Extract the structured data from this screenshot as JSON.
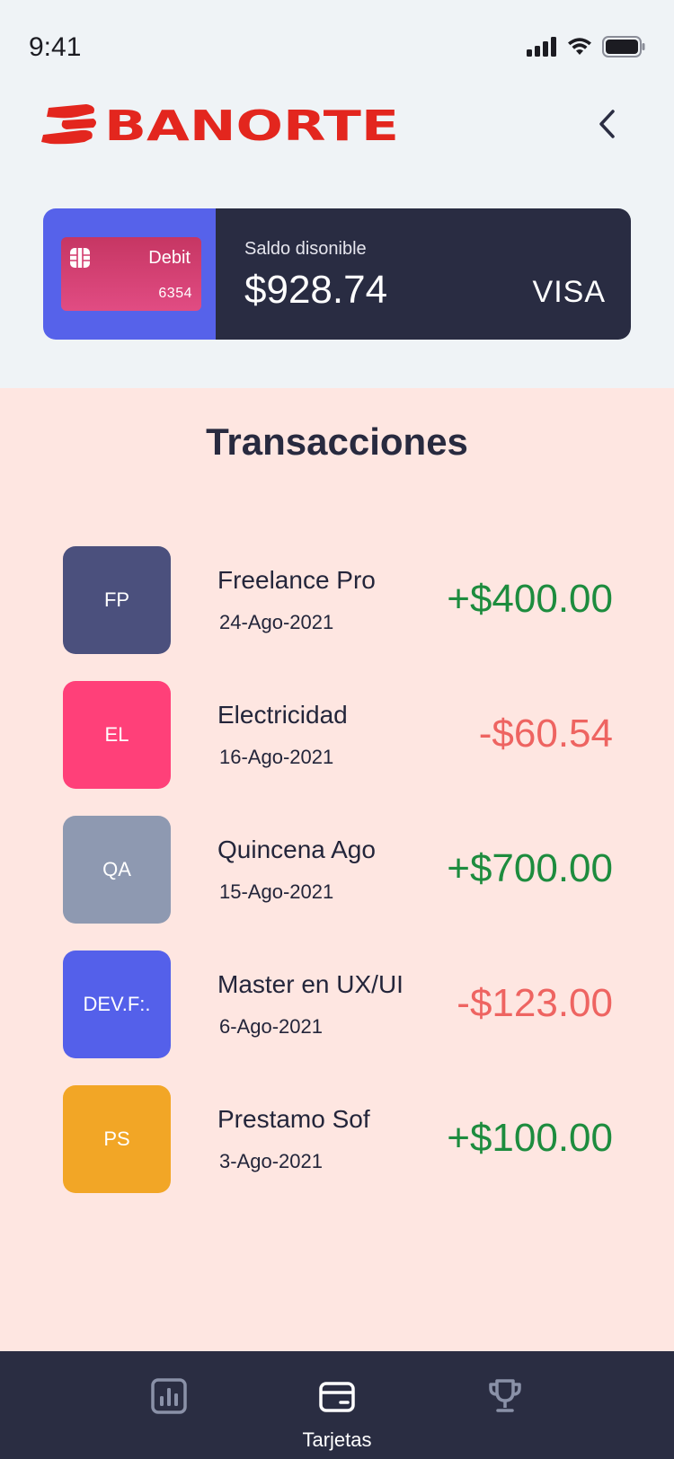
{
  "status": {
    "time": "9:41"
  },
  "header": {
    "brand": "BANORTE"
  },
  "account": {
    "card_type": "Debit",
    "card_last_digits": "6354",
    "balance_label": "Saldo disonible",
    "balance": "$928.74",
    "network": "VISA"
  },
  "transactions": {
    "title": "Transacciones",
    "items": [
      {
        "initials": "FP",
        "name": "Freelance Pro",
        "date": "24-Ago-2021",
        "amount": "+$400.00",
        "avatar_color": "#4B507D",
        "amount_color": "#1D8C3E"
      },
      {
        "initials": "EL",
        "name": "Electricidad",
        "date": "16-Ago-2021",
        "amount": "-$60.54",
        "avatar_color": "#FF4079",
        "amount_color": "#EE6461"
      },
      {
        "initials": "QA",
        "name": "Quincena Ago",
        "date": "15-Ago-2021",
        "amount": "+$700.00",
        "avatar_color": "#8E99B1",
        "amount_color": "#1D8C3E"
      },
      {
        "initials": "DEV.F:.",
        "name": "Master en UX/UI",
        "date": "6-Ago-2021",
        "amount": "-$123.00",
        "avatar_color": "#5460EA",
        "amount_color": "#EE6461"
      },
      {
        "initials": "PS",
        "name": "Prestamo Sof",
        "date": "3-Ago-2021",
        "amount": "+$100.00",
        "avatar_color": "#F2A626",
        "amount_color": "#1D8C3E"
      }
    ]
  },
  "tabbar": {
    "items": [
      {
        "icon": "bar-chart-icon",
        "label": ""
      },
      {
        "icon": "wallet-card-icon",
        "label": "Tarjetas"
      },
      {
        "icon": "trophy-icon",
        "label": ""
      }
    ]
  },
  "colors": {
    "brand_red": "#E3261E",
    "dark": "#282A3F",
    "accent_blue": "#5662EA",
    "positive": "#1D8C3E",
    "negative": "#EE6461"
  }
}
